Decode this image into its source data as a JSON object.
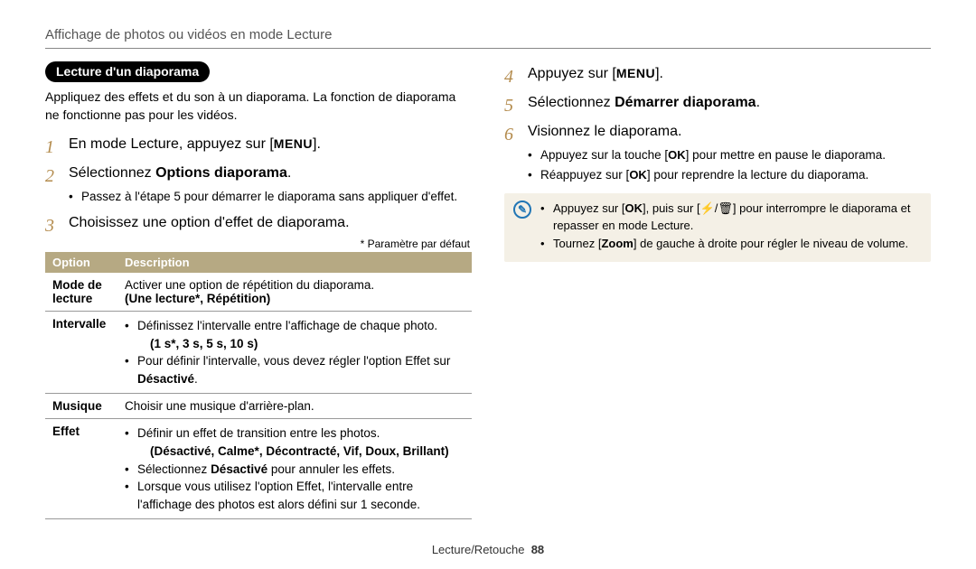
{
  "header": {
    "title": "Affichage de photos ou vidéos en mode Lecture"
  },
  "labels": {
    "section": "Lecture d'un diaporama"
  },
  "intro": "Appliquez des effets et du son à un diaporama. La fonction de diaporama ne fonctionne pas pour les vidéos.",
  "glyphs": {
    "menu": "MENU",
    "ok": "OK",
    "flash": "⚡/🗑"
  },
  "steps_left": {
    "1": {
      "pre": "En mode Lecture, appuyez sur [",
      "glyph": "menu",
      "post": "]."
    },
    "2": {
      "pre": "Sélectionnez ",
      "bold": "Options diaporama",
      "post": ".",
      "sub": [
        "Passez à l'étape 5 pour démarrer le diaporama sans appliquer d'effet."
      ]
    },
    "3": {
      "text": "Choisissez une option d'effet de diaporama."
    }
  },
  "table": {
    "caption": "* Paramètre par défaut",
    "headers": [
      "Option",
      "Description"
    ],
    "rows": [
      {
        "option": "Mode de lecture",
        "desc": [
          "Activer une option de répétition du diaporama."
        ],
        "bold_line": "(Une lecture*, Répétition)"
      },
      {
        "option": "Intervalle",
        "bullets": [
          {
            "text": "Définissez l'intervalle entre l'affichage de chaque photo.",
            "bold_line": "(1 s*, 3 s, 5 s, 10 s)"
          },
          {
            "text": "Pour définir l'intervalle, vous devez régler l'option Effet sur ",
            "bold_tail": "Désactivé",
            "post": "."
          }
        ]
      },
      {
        "option": "Musique",
        "desc": [
          "Choisir une musique d'arrière-plan."
        ]
      },
      {
        "option": "Effet",
        "bullets": [
          {
            "text": "Définir un effet de transition entre les photos.",
            "bold_line": "(Désactivé, Calme*, Décontracté, Vif, Doux, Brillant)"
          },
          {
            "text": "Sélectionnez ",
            "bold_inline": "Désactivé",
            "post": " pour annuler les effets."
          },
          {
            "text": "Lorsque vous utilisez l'option Effet, l'intervalle entre l'affichage des photos est alors défini sur 1 seconde."
          }
        ]
      }
    ]
  },
  "steps_right": {
    "4": {
      "pre": "Appuyez sur [",
      "glyph": "menu",
      "post": "]."
    },
    "5": {
      "pre": "Sélectionnez ",
      "bold": "Démarrer diaporama",
      "post": "."
    },
    "6": {
      "text": "Visionnez le diaporama.",
      "sub": [
        {
          "pre": "Appuyez sur la touche [",
          "glyph": "ok",
          "post": "] pour mettre en pause le diaporama."
        },
        {
          "pre": "Réappuyez sur [",
          "glyph": "ok",
          "post": "] pour reprendre la lecture du diaporama."
        }
      ]
    }
  },
  "note": {
    "items": [
      {
        "pre": "Appuyez sur [",
        "g1": "ok",
        "mid": "], puis sur [",
        "g2": "flash",
        "post": "] pour interrompre le diaporama et repasser en mode Lecture."
      },
      {
        "pre": "Tournez [",
        "bold": "Zoom",
        "post": "] de gauche à droite pour régler le niveau de volume."
      }
    ]
  },
  "footer": {
    "text": "Lecture/Retouche",
    "page": "88"
  }
}
